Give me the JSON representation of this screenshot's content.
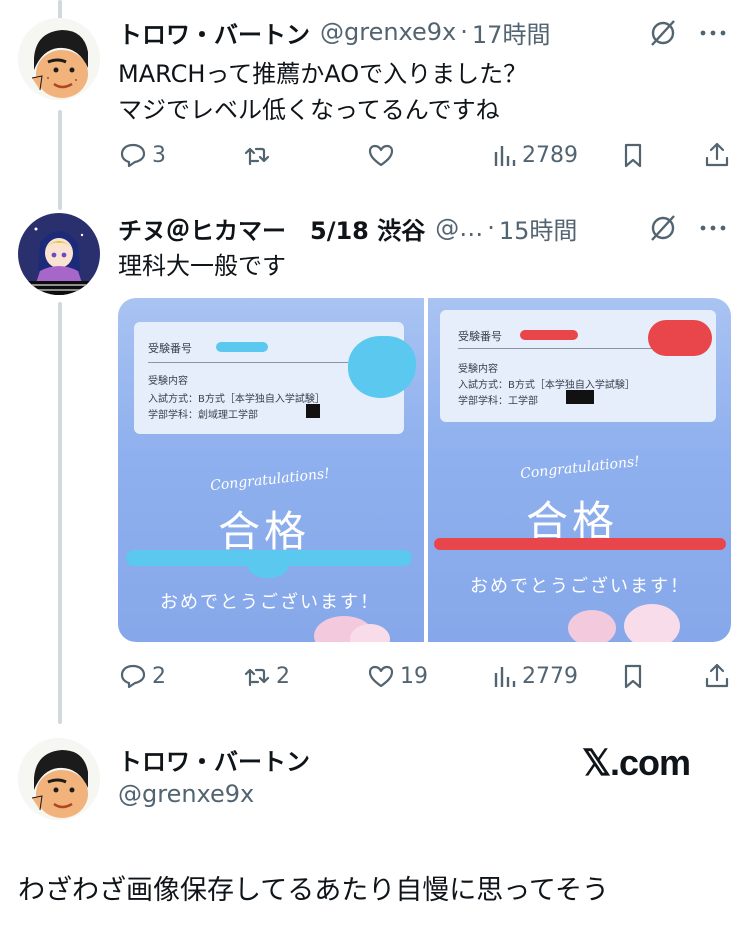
{
  "tweets": [
    {
      "name": "トロワ・バートン",
      "handle": "@grenxe9x",
      "time": "17時間",
      "text": "MARCHって推薦かAOで入りました？\nマジでレベル低くなってるんですね",
      "replies": "3",
      "retweets": "",
      "likes": "",
      "views": "2789"
    },
    {
      "name": "チヌ＠ヒカマー　5/18 渋谷",
      "handle": "@…",
      "time": "15時間",
      "text": "理科大一般です",
      "replies": "2",
      "retweets": "2",
      "likes": "19",
      "views": "2779"
    }
  ],
  "media": {
    "left": {
      "exam_no_label": "受験番号",
      "contents_label": "受験内容",
      "method": "入試方式：B方式［本学独自入学試験］",
      "faculty": "学部学科：創域理工学部",
      "congrats": "Congratulations!",
      "result": "合格",
      "message": "おめでとうございます！"
    },
    "right": {
      "exam_no_label": "受験番号",
      "contents_label": "受験内容",
      "method": "入試方式：B方式［本学独自入学試験］",
      "faculty": "学部学科：工学部",
      "congrats": "Congratulations!",
      "result": "合格",
      "message": "おめでとうございます！"
    }
  },
  "profile": {
    "name": "トロワ・バートン",
    "handle": "@grenxe9x"
  },
  "watermark": "𝕏.com",
  "caption": "わざわざ画像保存してるあたり自慢に思ってそう",
  "colors": {
    "text": "#0f1419",
    "secondary": "#536471",
    "thread_line": "#cfd9de",
    "redact_blue": "#5bc8f0",
    "redact_red": "#e8464a"
  },
  "icons": [
    "reply-icon",
    "retweet-icon",
    "like-icon",
    "views-icon",
    "bookmark-icon",
    "share-icon",
    "grok-icon",
    "more-icon"
  ]
}
